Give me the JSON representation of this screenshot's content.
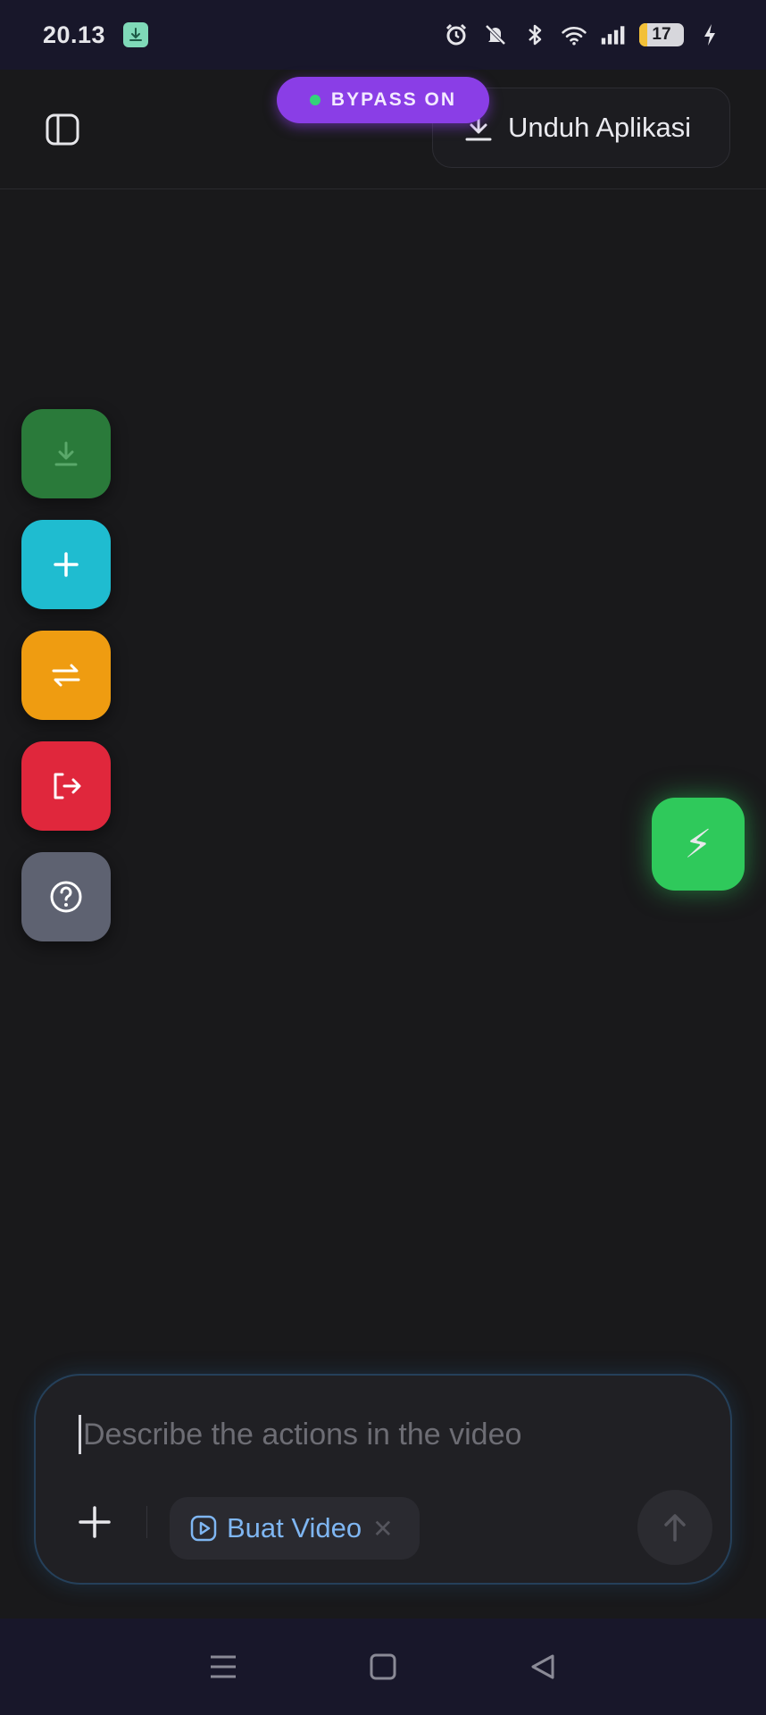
{
  "status_bar": {
    "time": "20.13",
    "battery_level": "17",
    "battery_fraction": 0.17,
    "icons": [
      "download-notification-icon",
      "alarm-icon",
      "mute-icon",
      "bluetooth-icon",
      "wifi-icon",
      "signal-icon",
      "battery-icon",
      "charging-icon"
    ]
  },
  "header": {
    "download_app_label": "Unduh Aplikasi",
    "bypass_label": "BYPASS ON",
    "bypass_color": "#8a3ee6"
  },
  "side_actions": [
    {
      "name": "download",
      "icon": "download-icon",
      "color": "#2a7a3a"
    },
    {
      "name": "add",
      "icon": "plus-icon",
      "color": "#1fbcd0"
    },
    {
      "name": "switch",
      "icon": "swap-icon",
      "color": "#ef9c11"
    },
    {
      "name": "logout",
      "icon": "logout-icon",
      "color": "#e0273c"
    },
    {
      "name": "help",
      "icon": "help-icon",
      "color": "#5e6271"
    }
  ],
  "bolt_button": {
    "icon": "lightning-bolt-icon",
    "glyph": "⚡",
    "color": "#2fc95b"
  },
  "composer": {
    "placeholder": "Describe the actions in the video",
    "value": "",
    "mode_chip_label": "Buat Video",
    "mode_chip_close": "✕",
    "accent": "#7fb6f2"
  },
  "nav_bar": {
    "buttons": [
      "menu-icon",
      "home-icon",
      "back-icon"
    ]
  }
}
